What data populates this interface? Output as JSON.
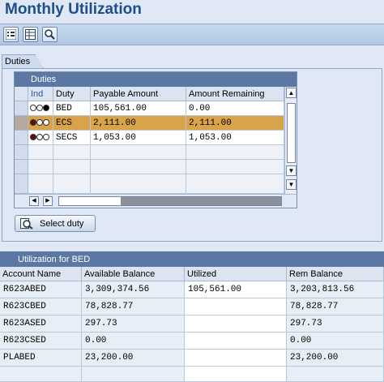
{
  "page": {
    "title": "Monthly Utilization"
  },
  "toolbar": {
    "buttons": [
      {
        "icon": "details-icon"
      },
      {
        "icon": "table-icon"
      },
      {
        "icon": "find-icon"
      }
    ]
  },
  "duties_group": {
    "tab_label": "Duties"
  },
  "duties_table": {
    "title": "Duties",
    "columns": [
      "Ind",
      "Duty",
      "Payable Amount",
      "Amount Remaining"
    ],
    "rows": [
      {
        "ind": "green",
        "duty": "BED",
        "payable": "105,561.00",
        "remaining": "0.00",
        "selected": false
      },
      {
        "ind": "red",
        "duty": "ECS",
        "payable": "2,111.00",
        "remaining": "2,111.00",
        "selected": true
      },
      {
        "ind": "red",
        "duty": "SECS",
        "payable": "1,053.00",
        "remaining": "1,053.00",
        "selected": false
      }
    ]
  },
  "select_button": {
    "label": "Select duty"
  },
  "utilization": {
    "title": "Utilization for BED",
    "columns": [
      "Account Name",
      "Available Balance",
      "Utilized",
      "Rem Balance"
    ],
    "rows": [
      {
        "account": "R623ABED",
        "available": "3,309,374.56",
        "utilized": "105,561.00",
        "remaining": "3,203,813.56"
      },
      {
        "account": "R623CBED",
        "available": "78,828.77",
        "utilized": "",
        "remaining": "78,828.77"
      },
      {
        "account": "R623ASED",
        "available": "297.73",
        "utilized": "",
        "remaining": "297.73"
      },
      {
        "account": "R623CSED",
        "available": "0.00",
        "utilized": "",
        "remaining": "0.00"
      },
      {
        "account": "PLABED",
        "available": "23,200.00",
        "utilized": "",
        "remaining": "23,200.00"
      }
    ]
  },
  "colors": {
    "title": "#1e4f8a",
    "table_header": "#5b78a4",
    "selected_row": "#d9a34a"
  }
}
